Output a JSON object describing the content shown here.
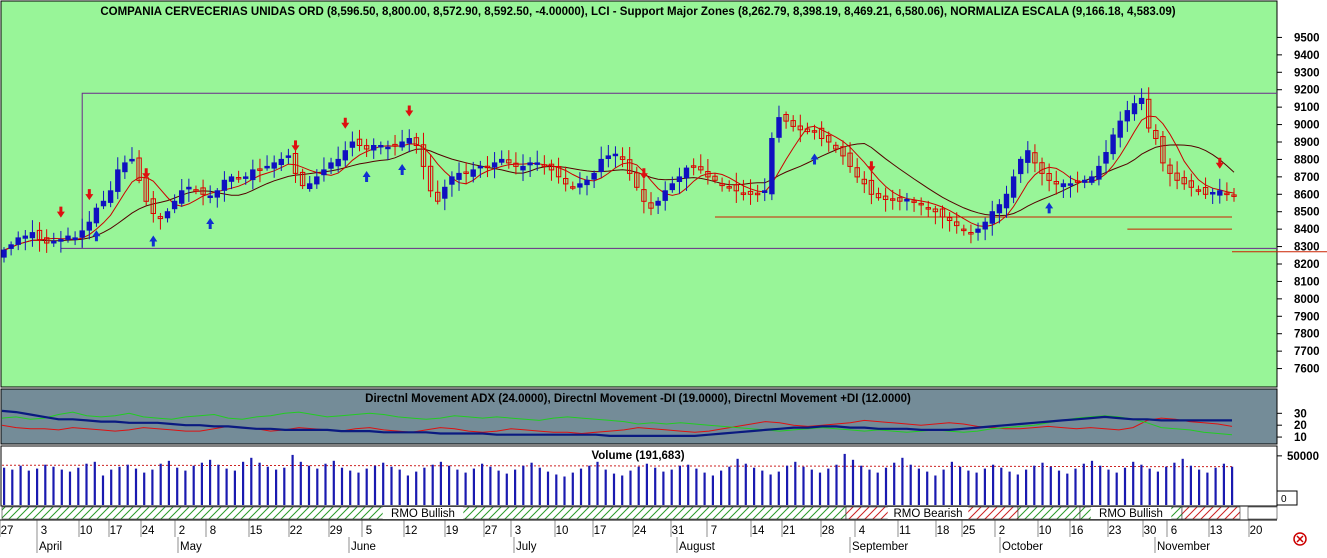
{
  "colors": {
    "price_bg": "#98f598",
    "adx_bg": "#748c98",
    "volume_bg": "#ffffff",
    "up_candle": "#1010c0",
    "down_candle": "#dd0000",
    "ma_fast": "#cc0000",
    "ma_slow": "#550000",
    "major_zone_line": "#6a2a8a",
    "support_line": "#cc2200",
    "adx_line": "#0a1a80",
    "minus_di_line": "#dd1111",
    "plus_di_line": "#22cc22",
    "volume_bar": "#1a1ab0",
    "rmo_bullish": "#2a9a2a",
    "rmo_bearish": "#cc2222"
  },
  "chart_data": [
    {
      "type": "candlestick",
      "title": "COMPANIA CERVECERIAS UNIDAS ORD (8,596.50, 8,800.00, 8,572.90, 8,592.50, -4.00000), LCI - Support Major Zones (8,262.79, 8,398.19, 8,469.21, 6,580.06), NORMALIZA ESCALA (9,166.18, 4,583.09)",
      "last_bar": {
        "open": 8596.5,
        "high": 8800.0,
        "low": 8572.9,
        "close": 8592.5,
        "change": -4.0
      },
      "ylim": [
        7500,
        9600
      ],
      "yticks": [
        7600,
        7700,
        7800,
        7900,
        8000,
        8100,
        8200,
        8300,
        8400,
        8500,
        8600,
        8700,
        8800,
        8900,
        9000,
        9100,
        9200,
        9300,
        9400,
        9500
      ],
      "major_zone_levels": [
        9180,
        8290
      ],
      "support_levels": [
        8470,
        8400,
        8270
      ],
      "support_zones": [
        8262.79,
        8398.19,
        8469.21,
        6580.06
      ],
      "normaliza_escala": [
        9166.18,
        4583.09
      ],
      "closes": [
        8280,
        8310,
        8350,
        8360,
        8380,
        8340,
        8320,
        8330,
        8340,
        8360,
        8350,
        8390,
        8440,
        8520,
        8560,
        8620,
        8740,
        8780,
        8800,
        8680,
        8560,
        8490,
        8460,
        8500,
        8560,
        8620,
        8640,
        8620,
        8600,
        8590,
        8620,
        8680,
        8700,
        8690,
        8700,
        8740,
        8740,
        8760,
        8780,
        8800,
        8820,
        8720,
        8650,
        8660,
        8700,
        8740,
        8780,
        8800,
        8850,
        8900,
        8880,
        8860,
        8880,
        8880,
        8870,
        8880,
        8900,
        8920,
        8880,
        8760,
        8620,
        8560,
        8640,
        8700,
        8720,
        8720,
        8740,
        8760,
        8760,
        8780,
        8800,
        8780,
        8760,
        8760,
        8780,
        8780,
        8760,
        8740,
        8700,
        8660,
        8640,
        8660,
        8680,
        8720,
        8800,
        8820,
        8830,
        8800,
        8720,
        8640,
        8560,
        8520,
        8560,
        8620,
        8660,
        8700,
        8750,
        8760,
        8740,
        8700,
        8680,
        8650,
        8640,
        8620,
        8600,
        8600,
        8600,
        8620,
        8920,
        9040,
        9020,
        8990,
        8970,
        8960,
        8960,
        8920,
        8900,
        8860,
        8820,
        8760,
        8700,
        8660,
        8600,
        8580,
        8570,
        8570,
        8560,
        8570,
        8560,
        8540,
        8520,
        8500,
        8470,
        8450,
        8420,
        8400,
        8380,
        8400,
        8440,
        8500,
        8540,
        8600,
        8700,
        8800,
        8850,
        8780,
        8720,
        8680,
        8660,
        8660,
        8660,
        8670,
        8680,
        8700,
        8760,
        8840,
        8940,
        9020,
        9080,
        9120,
        9150,
        8980,
        8920,
        8780,
        8720,
        8680,
        8660,
        8640,
        8620,
        8600,
        8610,
        8620,
        8600,
        8592.5
      ],
      "buy_signals": [
        13,
        21,
        29,
        51,
        56,
        114,
        147
      ],
      "sell_signals": [
        8,
        12,
        20,
        41,
        48,
        57,
        90,
        122,
        171
      ],
      "x_ticks": [
        "27",
        "3",
        "10",
        "17",
        "24",
        "2",
        "8",
        "15",
        "22",
        "29",
        "5",
        "12",
        "19",
        "27",
        "3",
        "10",
        "17",
        "24",
        "31",
        "7",
        "14",
        "21",
        "28",
        "4",
        "11",
        "18",
        "25",
        "2",
        "10",
        "16",
        "23",
        "30",
        "6",
        "13",
        "20"
      ],
      "months": [
        "April",
        "May",
        "June",
        "July",
        "August",
        "September",
        "October",
        "November"
      ]
    },
    {
      "type": "line",
      "title": "Directnl Movement ADX (24.0000), Directnl Movement -DI (19.0000), Directnl Movement +DI (12.0000)",
      "ylim": [
        5,
        37
      ],
      "yticks": [
        10,
        20,
        30
      ],
      "series": [
        {
          "name": "Directnl Movement ADX",
          "last": 24.0,
          "values": [
            32,
            31,
            29,
            27,
            25,
            25,
            24,
            23,
            23,
            22,
            22,
            22,
            21,
            20,
            20,
            19,
            19,
            18,
            17,
            17,
            16,
            16,
            16,
            16,
            15,
            15,
            15,
            14,
            14,
            14,
            14,
            13,
            13,
            13,
            13,
            12,
            12,
            12,
            12,
            12,
            12,
            12,
            12,
            11,
            11,
            11,
            11,
            11,
            11,
            11,
            12,
            13,
            14,
            15,
            16,
            17,
            18,
            18,
            19,
            19,
            18,
            18,
            17,
            17,
            17,
            16,
            16,
            16,
            17,
            18,
            19,
            20,
            21,
            22,
            23,
            24,
            25,
            26,
            27,
            26,
            25,
            25,
            24,
            24,
            24,
            24,
            24,
            24
          ]
        },
        {
          "name": "Directnl Movement -DI",
          "last": 19.0,
          "values": [
            20,
            18,
            17,
            17,
            16,
            18,
            17,
            16,
            15,
            16,
            18,
            17,
            16,
            15,
            15,
            17,
            19,
            18,
            17,
            15,
            16,
            18,
            17,
            16,
            15,
            17,
            18,
            16,
            15,
            14,
            16,
            18,
            17,
            15,
            14,
            15,
            17,
            16,
            15,
            14,
            14,
            13,
            14,
            15,
            16,
            18,
            17,
            16,
            15,
            14,
            15,
            17,
            19,
            21,
            23,
            22,
            20,
            19,
            20,
            21,
            22,
            24,
            23,
            22,
            21,
            20,
            21,
            22,
            21,
            19,
            18,
            17,
            17,
            18,
            19,
            18,
            17,
            18,
            17,
            16,
            18,
            24,
            26,
            25,
            23,
            22,
            21,
            19
          ]
        },
        {
          "name": "Directnl Movement +DI",
          "last": 12.0,
          "values": [
            26,
            27,
            25,
            26,
            29,
            31,
            28,
            27,
            28,
            30,
            27,
            26,
            25,
            27,
            28,
            29,
            26,
            25,
            27,
            28,
            30,
            31,
            29,
            27,
            28,
            29,
            30,
            29,
            27,
            26,
            25,
            26,
            28,
            27,
            26,
            27,
            26,
            25,
            24,
            26,
            27,
            26,
            25,
            24,
            23,
            21,
            22,
            21,
            22,
            21,
            20,
            19,
            18,
            17,
            16,
            15,
            16,
            17,
            18,
            17,
            16,
            15,
            16,
            15,
            14,
            15,
            16,
            15,
            14,
            15,
            17,
            18,
            19,
            20,
            22,
            24,
            26,
            27,
            28,
            27,
            25,
            22,
            18,
            17,
            16,
            14,
            13,
            12
          ]
        }
      ]
    },
    {
      "type": "bar",
      "title": "Volume (191,683)",
      "last": 191683,
      "ylim": [
        0,
        58000
      ],
      "yticks": [
        0,
        50000
      ],
      "bar_count": 150,
      "values": [
        38000,
        36000,
        40000,
        35000,
        37000,
        41000,
        39000,
        36000,
        34000,
        38000,
        42000,
        44000,
        30000,
        36000,
        39000,
        41000,
        37000,
        33000,
        36000,
        42000,
        45000,
        38000,
        35000,
        40000,
        43000,
        46000,
        41000,
        37000,
        35000,
        44000,
        48000,
        43000,
        39000,
        36000,
        38000,
        51000,
        44000,
        40000,
        37000,
        42000,
        45000,
        38000,
        35000,
        33000,
        37000,
        40000,
        43000,
        39000,
        36000,
        30000,
        34000,
        38000,
        41000,
        44000,
        40000,
        36000,
        33000,
        37000,
        42000,
        39000,
        35000,
        32000,
        36000,
        40000,
        43000,
        38000,
        34000,
        31000,
        29000,
        33000,
        37000,
        40000,
        44000,
        36000,
        32000,
        30000,
        35000,
        39000,
        42000,
        38000,
        34000,
        36000,
        40000,
        41000,
        37000,
        33000,
        30000,
        35000,
        39000,
        47000,
        42000,
        38000,
        35000,
        31000,
        34000,
        40000,
        44000,
        39000,
        36000,
        33000,
        37000,
        41000,
        52000,
        46000,
        40000,
        36000,
        33000,
        38000,
        43000,
        48000,
        41000,
        37000,
        34000,
        30000,
        36000,
        44000,
        39000,
        35000,
        33000,
        37000,
        41000,
        38000,
        34000,
        31000,
        36000,
        40000,
        43000,
        39000,
        35000,
        32000,
        37000,
        42000,
        45000,
        40000,
        36000,
        33000,
        38000,
        44000,
        41000,
        37000,
        34000,
        39000,
        43000,
        47000,
        40000,
        36000,
        33000,
        38000,
        42000,
        39000
      ]
    }
  ],
  "rmo": [
    {
      "label": "RMO Bullish",
      "type": "bullish"
    },
    {
      "label": "RMO Bearish",
      "type": "bearish"
    },
    {
      "label": "RMO Bullish",
      "type": "bullish"
    }
  ],
  "icons": {
    "corner": "red-circle-close-icon"
  }
}
